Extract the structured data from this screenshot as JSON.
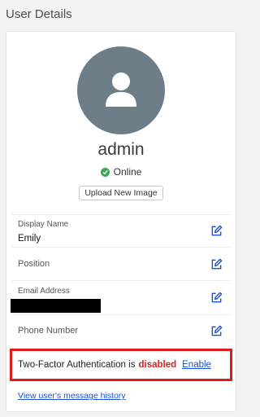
{
  "page": {
    "title": "User Details"
  },
  "profile": {
    "username": "admin",
    "status": "Online",
    "status_color": "#3aa757",
    "avatar_color": "#6d7e88",
    "upload_label": "Upload New Image"
  },
  "fields": {
    "display_name": {
      "label": "Display Name",
      "value": "Emily"
    },
    "position": {
      "label": "Position"
    },
    "email": {
      "label": "Email Address",
      "value_redacted": true
    },
    "phone": {
      "label": "Phone Number"
    }
  },
  "two_factor": {
    "text": "Two-Factor Authentication is",
    "state": "disabled",
    "action": "Enable",
    "highlight_color": "#e01a1a"
  },
  "history_link": "View user's message history",
  "icons": {
    "edit": "pencil-square-icon",
    "avatar": "user-silhouette-icon",
    "status": "check-circle-icon"
  }
}
